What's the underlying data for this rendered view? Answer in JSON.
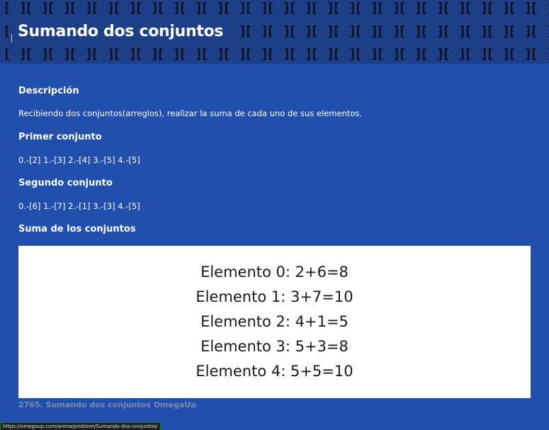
{
  "header": {
    "title": "Sumando dos conjuntos",
    "pattern_glyph": "[ ]"
  },
  "sections": {
    "description_heading": "Descripción",
    "description_text": "Recibiendo dos conjuntos(arreglos), realizar la suma de cada uno de sus elementos.",
    "first_set_heading": "Primer conjunto",
    "first_set_values": "0.-[2] 1.-[3] 2.-[4] 3.-[5] 4.-[5]",
    "second_set_heading": "Segundo conjunto",
    "second_set_values": "0.-[6] 1.-[7] 2.-[1] 3.-[3] 4.-[5]",
    "sum_heading": "Suma de los conjuntos"
  },
  "results": [
    "Elemento 0: 2+6=8",
    "Elemento 1: 3+7=10",
    "Elemento 2: 4+1=5",
    "Elemento 3: 5+3=8",
    "Elemento 4: 5+5=10"
  ],
  "footer": {
    "text": "2765. Sumando dos conjuntos OmegaUp"
  },
  "status_bar": {
    "url": "https://omegaup.com/arena/problem/Sumando-dos-conjuntos/"
  },
  "colors": {
    "page_background": "#214fae",
    "header_background": "#1c3f87",
    "text": "#ffffff",
    "footer_text": "#7d8aa6",
    "result_box": "#ffffff"
  }
}
